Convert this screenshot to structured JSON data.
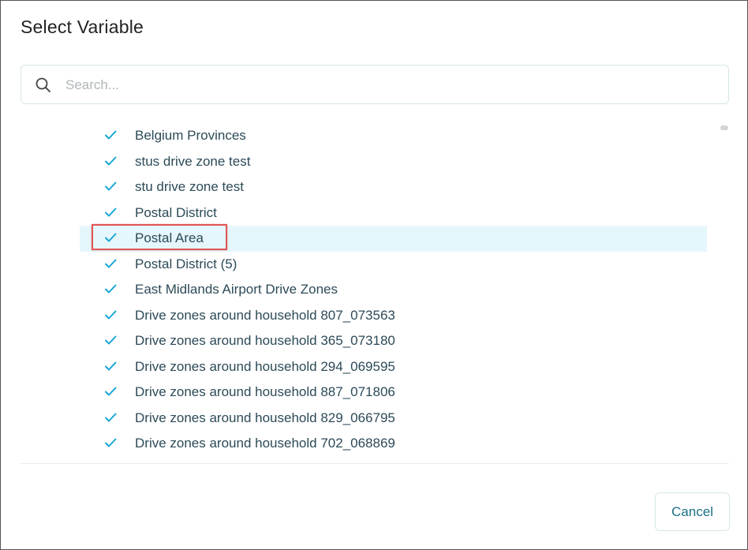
{
  "dialog": {
    "title": "Select Variable"
  },
  "search": {
    "placeholder": "Search...",
    "value": "",
    "icon": "search-icon"
  },
  "list": {
    "check_icon": "check-icon",
    "check_color": "#1aa6d6",
    "selected_bg": "#e5f7fc",
    "highlight_color": "#e05555",
    "items": [
      {
        "label": "Belgium Provinces",
        "checked": true,
        "selected": false
      },
      {
        "label": "stus drive zone test",
        "checked": true,
        "selected": false
      },
      {
        "label": "stu drive zone test",
        "checked": true,
        "selected": false
      },
      {
        "label": "Postal District",
        "checked": true,
        "selected": false
      },
      {
        "label": "Postal Area",
        "checked": true,
        "selected": true
      },
      {
        "label": "Postal District (5)",
        "checked": true,
        "selected": false
      },
      {
        "label": "East Midlands Airport Drive Zones",
        "checked": true,
        "selected": false
      },
      {
        "label": "Drive zones around household 807_073563",
        "checked": true,
        "selected": false
      },
      {
        "label": "Drive zones around household 365_073180",
        "checked": true,
        "selected": false
      },
      {
        "label": "Drive zones around household 294_069595",
        "checked": true,
        "selected": false
      },
      {
        "label": "Drive zones around household 887_071806",
        "checked": true,
        "selected": false
      },
      {
        "label": "Drive zones around household 829_066795",
        "checked": true,
        "selected": false
      },
      {
        "label": "Drive zones around household 702_068869",
        "checked": true,
        "selected": false
      }
    ]
  },
  "footer": {
    "cancel_label": "Cancel",
    "accent_color": "#1a6f86"
  }
}
